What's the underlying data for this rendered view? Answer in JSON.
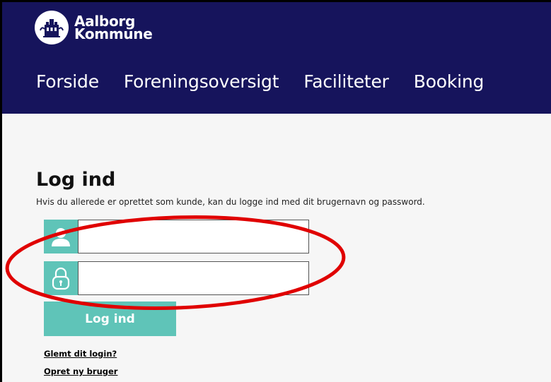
{
  "header": {
    "logo_line1": "Aalborg",
    "logo_line2": "Kommune",
    "background": "#16145c"
  },
  "nav": {
    "items": [
      {
        "label": "Forside"
      },
      {
        "label": "Foreningsoversigt"
      },
      {
        "label": "Faciliteter"
      },
      {
        "label": "Booking"
      }
    ]
  },
  "login": {
    "title": "Log ind",
    "subtitle": "Hvis du allerede er oprettet som kunde, kan du logge ind med dit brugernavn og password.",
    "username_value": "",
    "password_value": "",
    "username_icon": "user-icon",
    "password_icon": "lock-icon",
    "button_label": "Log ind",
    "accent": "#5fc4b8"
  },
  "links": {
    "forgot": "Glemt dit login?",
    "create": "Opret ny bruger"
  },
  "annotation": {
    "shape": "ellipse",
    "color": "#e00000"
  }
}
